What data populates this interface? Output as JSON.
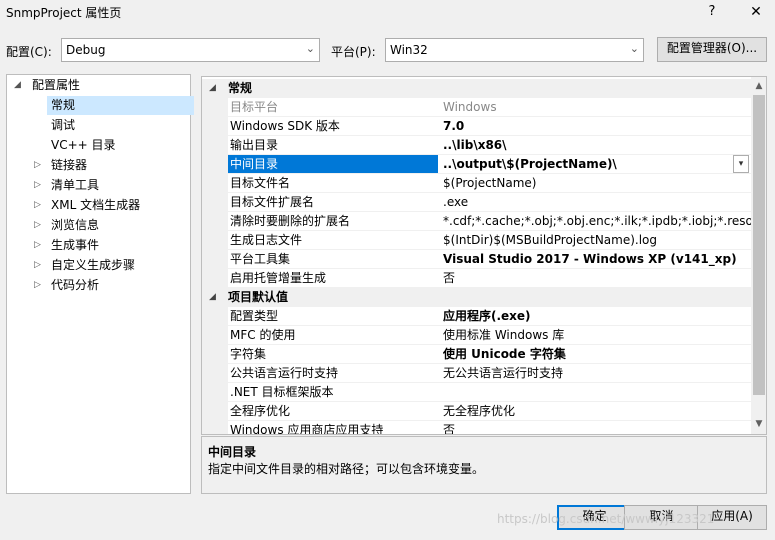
{
  "window": {
    "title": "SnmpProject 属性页",
    "help_label": "?",
    "close_label": "✕"
  },
  "config": {
    "config_label": "配置(C):",
    "config_value": "Debug",
    "platform_label": "平台(P):",
    "platform_value": "Win32",
    "manager_button": "配置管理器(O)..."
  },
  "tree": {
    "root": "配置属性",
    "items": [
      {
        "label": "常规",
        "expandable": false,
        "selected": true
      },
      {
        "label": "调试",
        "expandable": false
      },
      {
        "label": "VC++ 目录",
        "expandable": false
      },
      {
        "label": "链接器",
        "expandable": true
      },
      {
        "label": "清单工具",
        "expandable": true
      },
      {
        "label": "XML 文档生成器",
        "expandable": true
      },
      {
        "label": "浏览信息",
        "expandable": true
      },
      {
        "label": "生成事件",
        "expandable": true
      },
      {
        "label": "自定义生成步骤",
        "expandable": true
      },
      {
        "label": "代码分析",
        "expandable": true
      }
    ]
  },
  "grid": {
    "categories": [
      {
        "title": "常规"
      },
      {
        "title": "项目默认值"
      }
    ],
    "general_rows": [
      {
        "name": "目标平台",
        "value": "Windows",
        "bold": false,
        "disabled": true
      },
      {
        "name": "Windows SDK 版本",
        "value": "7.0",
        "bold": true
      },
      {
        "name": "输出目录",
        "value": "..\\lib\\x86\\",
        "bold": true
      },
      {
        "name": "中间目录",
        "value": "..\\output\\$(ProjectName)\\",
        "bold": true,
        "selected": true
      },
      {
        "name": "目标文件名",
        "value": "$(ProjectName)",
        "bold": false
      },
      {
        "name": "目标文件扩展名",
        "value": ".exe",
        "bold": false
      },
      {
        "name": "清除时要删除的扩展名",
        "value": "*.cdf;*.cache;*.obj;*.obj.enc;*.ilk;*.ipdb;*.iobj;*.resources",
        "bold": false
      },
      {
        "name": "生成日志文件",
        "value": "$(IntDir)$(MSBuildProjectName).log",
        "bold": false
      },
      {
        "name": "平台工具集",
        "value": "Visual Studio 2017 - Windows XP (v141_xp)",
        "bold": true
      },
      {
        "name": "启用托管增量生成",
        "value": "否",
        "bold": false
      }
    ],
    "default_rows": [
      {
        "name": "配置类型",
        "value": "应用程序(.exe)",
        "bold": true
      },
      {
        "name": "MFC 的使用",
        "value": "使用标准 Windows 库",
        "bold": false
      },
      {
        "name": "字符集",
        "value": "使用 Unicode 字符集",
        "bold": true
      },
      {
        "name": "公共语言运行时支持",
        "value": "无公共语言运行时支持",
        "bold": false
      },
      {
        "name": ".NET 目标框架版本",
        "value": "",
        "bold": false
      },
      {
        "name": "全程序优化",
        "value": "无全程序优化",
        "bold": false
      },
      {
        "name": "Windows 应用商店应用支持",
        "value": "否",
        "bold": false
      }
    ]
  },
  "description": {
    "title": "中间目录",
    "text": "指定中间文件目录的相对路径；可以包含环境变量。"
  },
  "buttons": {
    "ok": "确定",
    "cancel": "取消",
    "apply": "应用(A)"
  },
  "watermark": "https://blog.csdn.net/wwwlyj123321"
}
